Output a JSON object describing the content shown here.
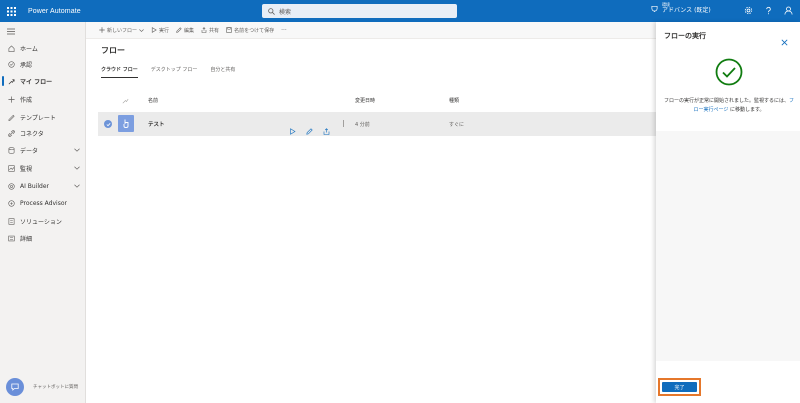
{
  "header": {
    "app_name": "Power Automate",
    "search_placeholder": "検索",
    "env_label": "環境",
    "env_name": "アドバンス (既定)"
  },
  "sidebar": {
    "items": [
      {
        "label": "ホーム",
        "icon": "home-icon"
      },
      {
        "label": "承認",
        "icon": "approval-icon"
      },
      {
        "label": "マイ フロー",
        "icon": "my-flows-icon",
        "active": true
      },
      {
        "label": "作成",
        "icon": "plus-icon"
      },
      {
        "label": "テンプレート",
        "icon": "template-icon"
      },
      {
        "label": "コネクタ",
        "icon": "connector-icon"
      },
      {
        "label": "データ",
        "icon": "data-icon",
        "expandable": true
      },
      {
        "label": "監視",
        "icon": "monitor-icon",
        "expandable": true
      },
      {
        "label": "AI Builder",
        "icon": "ai-builder-icon",
        "expandable": true
      },
      {
        "label": "Process Advisor",
        "icon": "process-advisor-icon"
      },
      {
        "label": "ソリューション",
        "icon": "solution-icon"
      },
      {
        "label": "詳細",
        "icon": "more-icon"
      }
    ],
    "chatbot_label": "チャットボットに質問"
  },
  "toolbar": {
    "new_flow": "新しいフロー",
    "run": "実行",
    "edit": "編集",
    "share": "共有",
    "save_as": "名前をつけて保存",
    "more": "···"
  },
  "main": {
    "title": "フロー",
    "tabs": [
      "クラウド フロー",
      "デスクトップ フロー",
      "自分と共有"
    ],
    "columns": {
      "name": "名前",
      "modified": "変更日時",
      "type": "種類"
    },
    "rows": [
      {
        "name": "テスト",
        "modified": "4 分前",
        "type": "すぐに"
      }
    ]
  },
  "panel": {
    "title": "フローの実行",
    "message_1": "フローの実行が正常に開始されました。監視するには、",
    "message_link": "フロー実行ページ",
    "message_2": " に移動します。",
    "done_label": "完了"
  },
  "colors": {
    "brand": "#0f6cbd",
    "success": "#107c10",
    "highlight": "#e5772b"
  }
}
